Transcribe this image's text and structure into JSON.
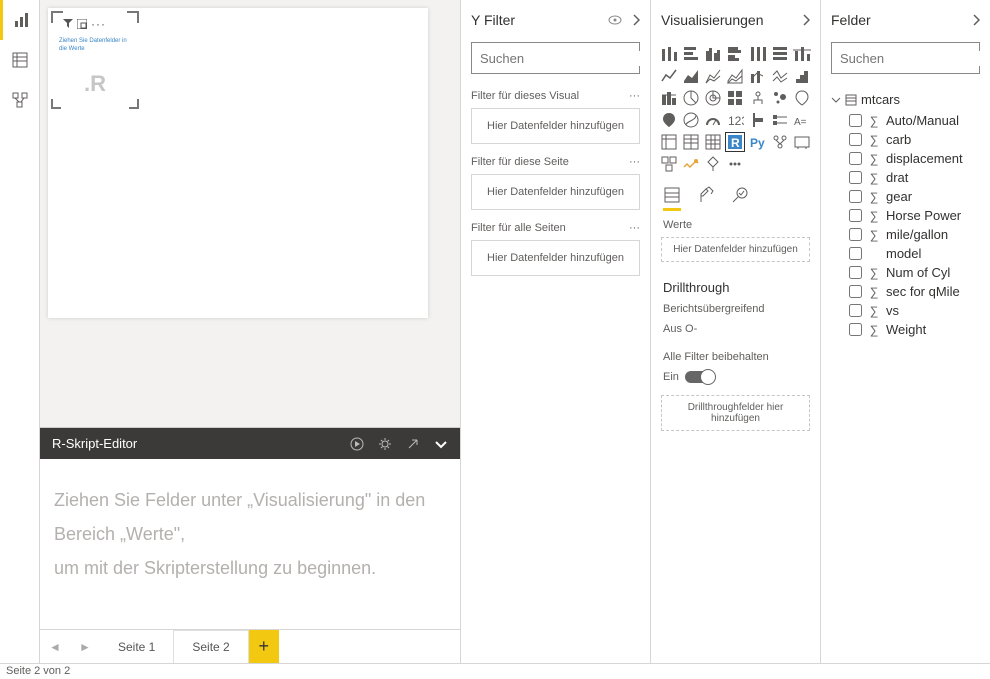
{
  "left_rail": {
    "items": [
      "report-view",
      "data-view",
      "model-view"
    ]
  },
  "canvas": {
    "visual_placeholder_hint": "Ziehen Sie Datenfelder in die Werte",
    "visual_r_badge": ".R"
  },
  "r_editor": {
    "title": "R-Skript-Editor",
    "body_line1": "Ziehen Sie Felder unter „Visualisierung\" in den Bereich „Werte\",",
    "body_line2": "um mit der Skripterstellung zu beginnen."
  },
  "tabs": {
    "pages": [
      "Seite 1",
      "Seite 2"
    ],
    "active_index": 1
  },
  "statusbar": "Seite 2 von 2",
  "filter": {
    "title": "Y Filter",
    "search_placeholder": "Suchen",
    "visual_label": "Filter für dieses Visual",
    "page_label": "Filter für diese Seite",
    "all_label": "Filter für alle Seiten",
    "drop_hint": "Hier Datenfelder hinzufügen"
  },
  "viz": {
    "title": "Visualisierungen",
    "values_label": "Werte",
    "values_hint": "Hier Datenfelder hinzufügen",
    "drill_title": "Drillthrough",
    "drill_cross": "Berichtsübergreifend",
    "drill_off": "Aus O-",
    "drill_keep": "Alle Filter beibehalten",
    "drill_on": "Ein",
    "drill_hint": "Drillthroughfelder hier hinzufügen"
  },
  "fields": {
    "title": "Felder",
    "search_placeholder": "Suchen",
    "table": "mtcars",
    "items": [
      {
        "name": "Auto/Manual",
        "sigma": true
      },
      {
        "name": "carb",
        "sigma": true
      },
      {
        "name": "displacement",
        "sigma": true
      },
      {
        "name": "drat",
        "sigma": true
      },
      {
        "name": "gear",
        "sigma": true
      },
      {
        "name": "Horse Power",
        "sigma": true
      },
      {
        "name": "mile/gallon",
        "sigma": true
      },
      {
        "name": "model",
        "sigma": false
      },
      {
        "name": "Num of Cyl",
        "sigma": true
      },
      {
        "name": "sec for qMile",
        "sigma": true
      },
      {
        "name": "vs",
        "sigma": true
      },
      {
        "name": "Weight",
        "sigma": true
      }
    ]
  }
}
